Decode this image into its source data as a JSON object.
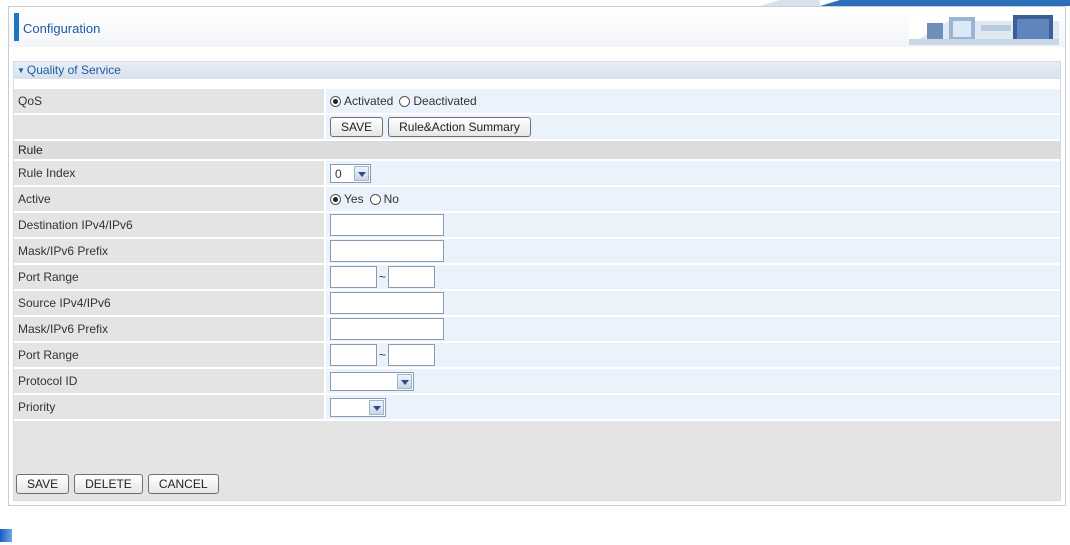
{
  "page": {
    "title": "Configuration"
  },
  "section": {
    "title": "Quality of Service"
  },
  "qos": {
    "label": "QoS",
    "options": [
      "Activated",
      "Deactivated"
    ],
    "selected": "Activated",
    "save_label": "SAVE",
    "summary_label": "Rule&Action Summary"
  },
  "rule": {
    "heading": "Rule",
    "index": {
      "label": "Rule Index",
      "value": "0"
    },
    "active": {
      "label": "Active",
      "options": [
        "Yes",
        "No"
      ],
      "selected": "Yes"
    },
    "dest_ip": {
      "label": "Destination IPv4/IPv6",
      "value": ""
    },
    "dest_mask": {
      "label": "Mask/IPv6 Prefix",
      "value": ""
    },
    "dest_port": {
      "label": "Port Range",
      "separator": "~",
      "from": "",
      "to": ""
    },
    "src_ip": {
      "label": "Source IPv4/IPv6",
      "value": ""
    },
    "src_mask": {
      "label": "Mask/IPv6 Prefix",
      "value": ""
    },
    "src_port": {
      "label": "Port Range",
      "separator": "~",
      "from": "",
      "to": ""
    },
    "protocol": {
      "label": "Protocol ID",
      "value": ""
    },
    "priority": {
      "label": "Priority",
      "value": ""
    }
  },
  "footer": {
    "save_label": "SAVE",
    "delete_label": "DELETE",
    "cancel_label": "CANCEL"
  },
  "colors": {
    "accent": "#1a78c2",
    "title_text": "#1e5aa8",
    "label_bg": "#e4e4e4",
    "value_bg": "#eaf2fb"
  },
  "icons": {
    "section_toggle": "triangle-down-icon",
    "banner": "office-banner-graphic"
  }
}
